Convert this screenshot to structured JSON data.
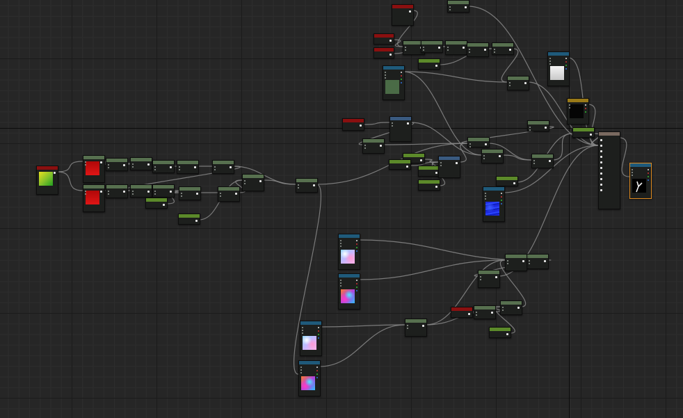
{
  "canvas": {
    "background": "#262626"
  },
  "colors": {
    "wire": "#8a8a8a",
    "param_header": "#8a1010",
    "texture_header": "#1f5a7a",
    "math_header": "#57704f",
    "constant_header": "#5c8a2a",
    "coordinate_header": "#3a5a80",
    "ifelse_header": "#9a7a18",
    "output_header": "#7a6a60",
    "selection_outline": "#e08a1e"
  },
  "nodes": [
    {
      "id": "n1",
      "kind": "param",
      "pins": 1,
      "thumb": "yellow-green-gradient",
      "thumb_color": "#7fbf2a"
    },
    {
      "id": "n2",
      "kind": "math",
      "pins": 1,
      "thumb": "red-fill",
      "thumb_color": "#d11010"
    },
    {
      "id": "n3",
      "kind": "math",
      "pins": 1,
      "thumb": "red-fill",
      "thumb_color": "#d11010"
    },
    {
      "id": "n4",
      "kind": "math",
      "pins": 1
    },
    {
      "id": "n5",
      "kind": "math",
      "pins": 1
    },
    {
      "id": "n6",
      "kind": "math",
      "pins": 1
    },
    {
      "id": "n7",
      "kind": "math",
      "pins": 1
    },
    {
      "id": "n8",
      "kind": "math",
      "pins": 1
    },
    {
      "id": "n9",
      "kind": "math",
      "pins": 1
    },
    {
      "id": "n10",
      "kind": "math",
      "pins": 1
    },
    {
      "id": "n11",
      "kind": "math",
      "pins": 1
    },
    {
      "id": "n12",
      "kind": "constant",
      "pins": 1
    },
    {
      "id": "n13",
      "kind": "math",
      "pins": 1
    },
    {
      "id": "n14",
      "kind": "math",
      "pins": 1
    },
    {
      "id": "n15",
      "kind": "constant",
      "pins": 1
    },
    {
      "id": "n16",
      "kind": "math",
      "pins": 1
    },
    {
      "id": "n17",
      "kind": "math",
      "pins": 1
    },
    {
      "id": "n18",
      "kind": "param",
      "pins": 1
    },
    {
      "id": "n19",
      "kind": "param",
      "pins": 1
    },
    {
      "id": "n20",
      "kind": "param",
      "pins": 1
    },
    {
      "id": "n21",
      "kind": "math",
      "pins": 1
    },
    {
      "id": "n22",
      "kind": "math",
      "pins": 1
    },
    {
      "id": "n23",
      "kind": "math",
      "pins": 1
    },
    {
      "id": "n24",
      "kind": "math",
      "pins": 1
    },
    {
      "id": "n25",
      "kind": "math",
      "pins": 1
    },
    {
      "id": "n26",
      "kind": "constant",
      "pins": 1
    },
    {
      "id": "n27",
      "kind": "texture",
      "pins": 4,
      "thumb": "dark-green-fill",
      "thumb_color": "#4a6b46"
    },
    {
      "id": "n28",
      "kind": "math",
      "pins": 1
    },
    {
      "id": "n29",
      "kind": "math",
      "pins": 1
    },
    {
      "id": "n30",
      "kind": "texture",
      "pins": 4,
      "thumb": "white-fill",
      "thumb_color": "#dcdcdc"
    },
    {
      "id": "n31",
      "kind": "ifelse",
      "pins": 3,
      "thumb": "black-fill",
      "thumb_color": "#050505"
    },
    {
      "id": "n32",
      "kind": "param",
      "pins": 1
    },
    {
      "id": "n33",
      "kind": "coordinate",
      "pins": 2
    },
    {
      "id": "n34",
      "kind": "math",
      "pins": 1
    },
    {
      "id": "n35",
      "kind": "math",
      "pins": 1
    },
    {
      "id": "n36",
      "kind": "constant",
      "pins": 1
    },
    {
      "id": "n37",
      "kind": "constant",
      "pins": 1
    },
    {
      "id": "n38",
      "kind": "constant",
      "pins": 1
    },
    {
      "id": "n39",
      "kind": "constant",
      "pins": 1
    },
    {
      "id": "n40",
      "kind": "coordinate",
      "pins": 2
    },
    {
      "id": "n41",
      "kind": "math",
      "pins": 1
    },
    {
      "id": "n42",
      "kind": "math",
      "pins": 1
    },
    {
      "id": "n43",
      "kind": "math",
      "pins": 1
    },
    {
      "id": "n44",
      "kind": "constant",
      "pins": 1
    },
    {
      "id": "n45",
      "kind": "texture",
      "pins": 4,
      "thumb": "blue-water",
      "thumb_color": "#1e2ae0"
    },
    {
      "id": "n46",
      "kind": "math",
      "pins": 1
    },
    {
      "id": "n47",
      "kind": "constant",
      "pins": 1
    },
    {
      "id": "n48",
      "kind": "output",
      "pins": 10
    },
    {
      "id": "n49",
      "kind": "texture",
      "pins": 4,
      "thumb": "white-on-black-shape",
      "thumb_color": "#000000",
      "selected": true
    },
    {
      "id": "n50",
      "kind": "texture",
      "pins": 4,
      "thumb": "iridescent-pastel",
      "thumb_color": "#b8c4ff"
    },
    {
      "id": "n51",
      "kind": "texture",
      "pins": 4,
      "thumb": "iridescent-saturated",
      "thumb_color": "#c06ae0"
    },
    {
      "id": "n52",
      "kind": "math",
      "pins": 1
    },
    {
      "id": "n53",
      "kind": "math",
      "pins": 1
    },
    {
      "id": "n54",
      "kind": "math",
      "pins": 1
    },
    {
      "id": "n55",
      "kind": "param",
      "pins": 1
    },
    {
      "id": "n56",
      "kind": "math",
      "pins": 1
    },
    {
      "id": "n57",
      "kind": "math",
      "pins": 1
    },
    {
      "id": "n58",
      "kind": "constant",
      "pins": 1
    },
    {
      "id": "n59",
      "kind": "math",
      "pins": 1
    },
    {
      "id": "n60",
      "kind": "texture",
      "pins": 4,
      "thumb": "iridescent-pastel",
      "thumb_color": "#b8c4ff"
    },
    {
      "id": "n61",
      "kind": "texture",
      "pins": 4,
      "thumb": "iridescent-saturated",
      "thumb_color": "#c06ae0"
    }
  ],
  "wires": [
    [
      "n1",
      "n2"
    ],
    [
      "n1",
      "n3"
    ],
    [
      "n2",
      "n4"
    ],
    [
      "n4",
      "n5"
    ],
    [
      "n5",
      "n6"
    ],
    [
      "n6",
      "n7"
    ],
    [
      "n7",
      "n8"
    ],
    [
      "n8",
      "n10"
    ],
    [
      "n3",
      "n9"
    ],
    [
      "n9",
      "n10"
    ],
    [
      "n10",
      "n11"
    ],
    [
      "n11",
      "n13"
    ],
    [
      "n12",
      "n13"
    ],
    [
      "n13",
      "n14"
    ],
    [
      "n14",
      "n16"
    ],
    [
      "n15",
      "n16"
    ],
    [
      "n16",
      "n17"
    ],
    [
      "n8",
      "n17"
    ],
    [
      "n17",
      "n61"
    ],
    [
      "n17",
      "n41"
    ],
    [
      "n18",
      "n21"
    ],
    [
      "n19",
      "n21"
    ],
    [
      "n20",
      "n22"
    ],
    [
      "n21",
      "n23"
    ],
    [
      "n22",
      "n23"
    ],
    [
      "n23",
      "n24"
    ],
    [
      "n24",
      "n25"
    ],
    [
      "n25",
      "n29"
    ],
    [
      "n26",
      "n25"
    ],
    [
      "n27",
      "n29"
    ],
    [
      "n27",
      "n42"
    ],
    [
      "n29",
      "n48"
    ],
    [
      "n30",
      "n48"
    ],
    [
      "n31",
      "n48"
    ],
    [
      "n32",
      "n33"
    ],
    [
      "n33",
      "n34"
    ],
    [
      "n34",
      "n41"
    ],
    [
      "n35",
      "n41"
    ],
    [
      "n33",
      "n42"
    ],
    [
      "n36",
      "n40"
    ],
    [
      "n37",
      "n40"
    ],
    [
      "n38",
      "n40"
    ],
    [
      "n39",
      "n40"
    ],
    [
      "n40",
      "n41"
    ],
    [
      "n41",
      "n43"
    ],
    [
      "n42",
      "n43"
    ],
    [
      "n43",
      "n46"
    ],
    [
      "n44",
      "n46"
    ],
    [
      "n46",
      "n48"
    ],
    [
      "n45",
      "n48"
    ],
    [
      "n47",
      "n48"
    ],
    [
      "n28",
      "n48"
    ],
    [
      "n48",
      "n49"
    ],
    [
      "n50",
      "n52"
    ],
    [
      "n51",
      "n53"
    ],
    [
      "n52",
      "n53"
    ],
    [
      "n53",
      "n54"
    ],
    [
      "n54",
      "n48"
    ],
    [
      "n55",
      "n56"
    ],
    [
      "n56",
      "n57"
    ],
    [
      "n57",
      "n53"
    ],
    [
      "n58",
      "n57"
    ],
    [
      "n60",
      "n59"
    ],
    [
      "n61",
      "n59"
    ],
    [
      "n59",
      "n53"
    ],
    [
      "n59",
      "n57"
    ]
  ]
}
